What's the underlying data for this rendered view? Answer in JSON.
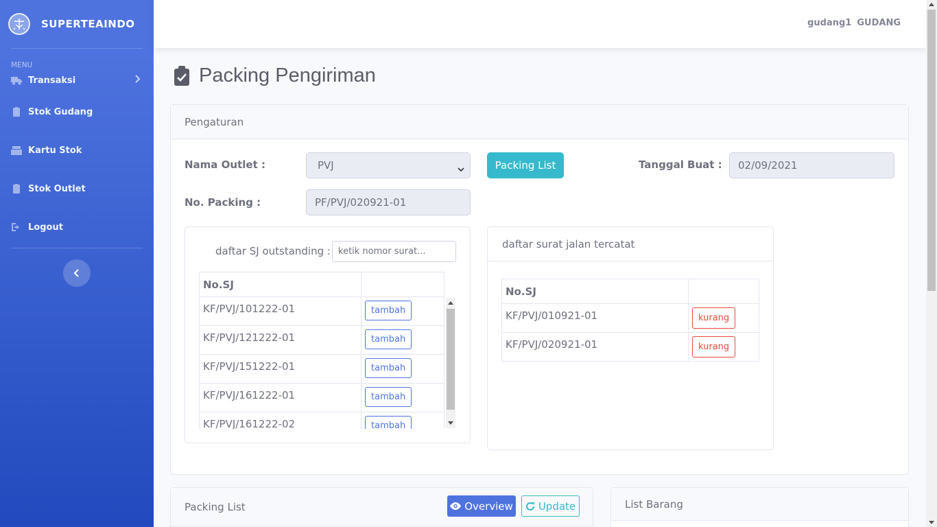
{
  "brand": {
    "name": "SUPERTEAINDO"
  },
  "sidebar": {
    "heading": "MENU",
    "items": [
      {
        "label": "Transaksi",
        "icon": "truck-icon"
      },
      {
        "label": "Stok Gudang",
        "icon": "clipboard-icon"
      },
      {
        "label": "Kartu Stok",
        "icon": "cash-register-icon"
      },
      {
        "label": "Stok Outlet",
        "icon": "clipboard-icon"
      },
      {
        "label": "Logout",
        "icon": "sign-out-icon"
      }
    ]
  },
  "topbar": {
    "username": "gudang1",
    "role": "GUDANG"
  },
  "page": {
    "title": "Packing Pengiriman"
  },
  "pengaturan": {
    "header": "Pengaturan",
    "nama_outlet_label": "Nama Outlet :",
    "nama_outlet_value": "PVJ",
    "packing_list_button": "Packing List",
    "tanggal_label": "Tanggal Buat :",
    "tanggal_value": "02/09/2021",
    "no_packing_label": "No. Packing :",
    "no_packing_value": "PF/PVJ/020921-01"
  },
  "outstanding": {
    "label": "daftar SJ outstanding :",
    "search_placeholder": "ketik nomor surat...",
    "col_header": "No.SJ",
    "rows": [
      {
        "no": "KF/PVJ/101222-01",
        "action": "tambah"
      },
      {
        "no": "KF/PVJ/121222-01",
        "action": "tambah"
      },
      {
        "no": "KF/PVJ/151222-01",
        "action": "tambah"
      },
      {
        "no": "KF/PVJ/161222-01",
        "action": "tambah"
      },
      {
        "no": "KF/PVJ/161222-02",
        "action": "tambah"
      }
    ]
  },
  "tercatat": {
    "header": "daftar surat jalan tercatat",
    "col_header": "No.SJ",
    "rows": [
      {
        "no": "KF/PVJ/010921-01",
        "action": "kurang"
      },
      {
        "no": "KF/PVJ/020921-01",
        "action": "kurang"
      }
    ]
  },
  "packing_list": {
    "header": "Packing List",
    "overview_button": "Overview",
    "update_button": "Update"
  },
  "list_barang": {
    "header": "List Barang"
  },
  "colors": {
    "primary": "#4e73df",
    "info": "#36b9cc",
    "danger": "#e74a3b"
  }
}
